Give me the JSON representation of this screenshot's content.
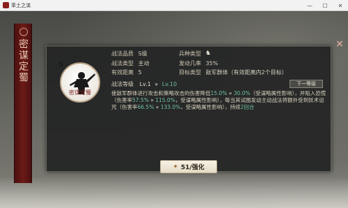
{
  "window": {
    "title": "率土之滨",
    "min": "—",
    "max": "☐",
    "close": "✕"
  },
  "banner": {
    "text": "密谋定蜀"
  },
  "skill": {
    "grade_badge": "S",
    "icon_name": "密谋定蜀",
    "quality_label": "战法品质",
    "quality_value": "S级",
    "troop_label": "兵种类型",
    "type_label": "战法类型",
    "type_value": "主动",
    "trigger_label": "发动几率",
    "trigger_value": "35%",
    "range_label": "有效距离",
    "range_value": "5",
    "target_label": "目标类型",
    "target_value": "敌军群体（有效距离内2个目标）"
  },
  "level": {
    "label": "战法等级",
    "current": "Lv.1",
    "arrow": "»",
    "next": "Lv.10",
    "next_button": "下一等级"
  },
  "description": {
    "part1": "使敌军群体进行攻击和策略攻击的伤害降低",
    "v1a": "15.0%",
    "arrow": "»",
    "v1b": "30.0%",
    "part2": "（受谋略属性影响），并陷入恐慌（伤害率",
    "v2a": "57.5%",
    "v2b": "115.0%",
    "part3": "，受谋略属性影响），每当其试图发动主动战法将额外受到妖术诅咒（伤害率",
    "v3a": "66.5%",
    "v3b": "133.0%",
    "part4": "，受谋略属性影响），持续",
    "v4": "2回合"
  },
  "upgrade_button": {
    "label": "51/强化"
  }
}
